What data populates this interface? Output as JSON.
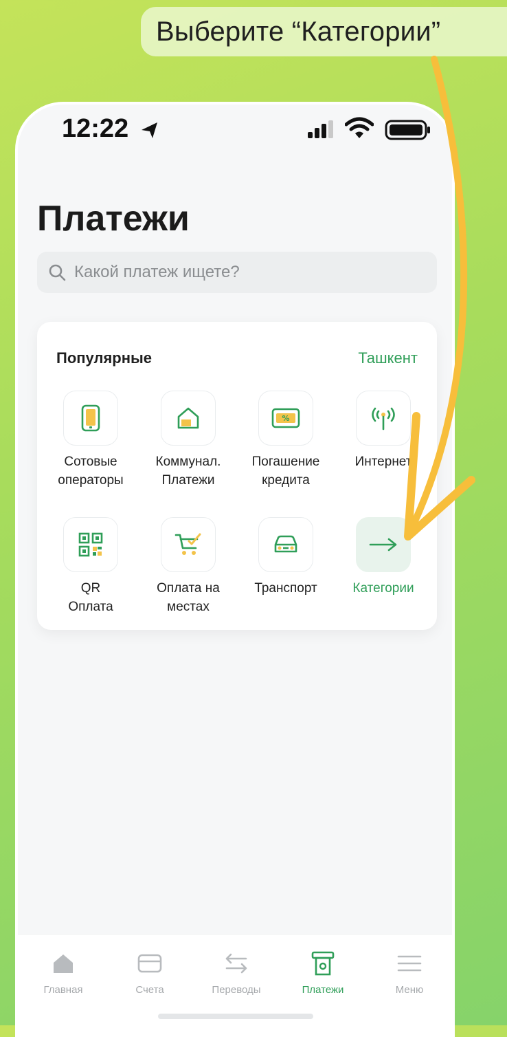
{
  "hint": {
    "text": "Выберите “Категории”"
  },
  "status_bar": {
    "time": "12:22"
  },
  "page": {
    "title": "Платежи"
  },
  "search": {
    "placeholder": "Какой платеж ищете?"
  },
  "popular": {
    "heading": "Популярные",
    "city": "Ташкент",
    "items": [
      {
        "label": "Сотовые\nоператоры",
        "icon": "phone-icon"
      },
      {
        "label": "Коммунал.\nПлатежи",
        "icon": "house-icon"
      },
      {
        "label": "Погашение\nкредита",
        "icon": "credit-card-icon"
      },
      {
        "label": "Интернет",
        "icon": "antenna-icon"
      },
      {
        "label": "QR\nОплата",
        "icon": "qr-code-icon"
      },
      {
        "label": "Оплата на\nместах",
        "icon": "cart-icon"
      },
      {
        "label": "Транспорт",
        "icon": "car-icon"
      },
      {
        "label": "Категории",
        "icon": "arrow-right-icon"
      }
    ]
  },
  "tabbar": {
    "items": [
      {
        "label": "Главная",
        "icon": "home-icon"
      },
      {
        "label": "Счета",
        "icon": "card-icon"
      },
      {
        "label": "Переводы",
        "icon": "transfer-icon"
      },
      {
        "label": "Платежи",
        "icon": "payments-icon",
        "active": true
      },
      {
        "label": "Меню",
        "icon": "menu-icon"
      }
    ]
  },
  "colors": {
    "accent": "#2f9e58",
    "annotation_arrow": "#f7be3b",
    "icon_yellow": "#f3c34a"
  }
}
